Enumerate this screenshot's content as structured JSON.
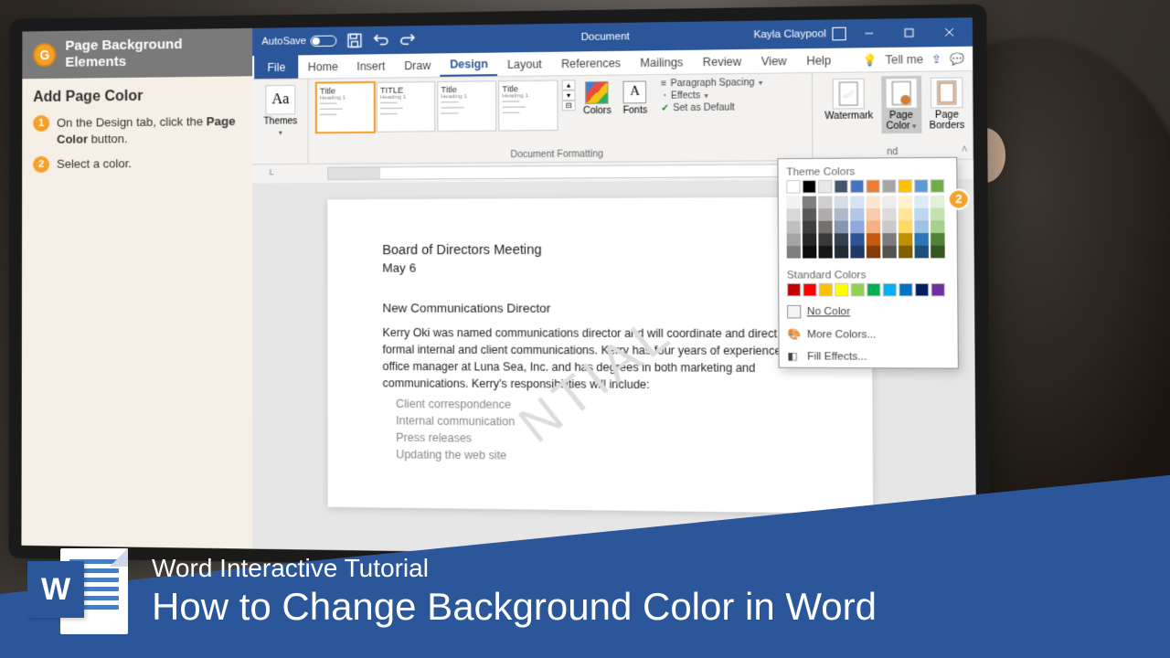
{
  "sidebar": {
    "badge": "G",
    "title": "Page Background Elements",
    "subtitle": "Add Page Color",
    "steps": [
      {
        "num": "1",
        "html": "On the Design tab, click the <b>Page Color</b> button."
      },
      {
        "num": "2",
        "html": "Select a color."
      }
    ]
  },
  "titlebar": {
    "autosave": "AutoSave",
    "autosave_state": "Off",
    "document": "Document",
    "username": "Kayla Claypool"
  },
  "tabs": {
    "file": "File",
    "items": [
      "Home",
      "Insert",
      "Draw",
      "Design",
      "Layout",
      "References",
      "Mailings",
      "Review",
      "View",
      "Help"
    ],
    "active": "Design",
    "tell_me": "Tell me"
  },
  "ribbon": {
    "themes": "Themes",
    "doc_formatting": "Document Formatting",
    "styles": [
      {
        "title": "Title",
        "sub": "Heading 1"
      },
      {
        "title": "TITLE",
        "sub": "Heading 1"
      },
      {
        "title": "Title",
        "sub": "Heading 1"
      },
      {
        "title": "Title",
        "sub": "Heading 1"
      }
    ],
    "colors": "Colors",
    "fonts": "Fonts",
    "paragraph_spacing": "Paragraph Spacing",
    "effects": "Effects",
    "set_default": "Set as Default",
    "watermark": "Watermark",
    "page_color": "Page Color",
    "page_borders": "Page Borders",
    "bg_group": "nd"
  },
  "callout2": "2",
  "picker": {
    "theme": "Theme Colors",
    "standard": "Standard Colors",
    "no_color": "No Color",
    "more": "More Colors...",
    "fill": "Fill Effects...",
    "theme_row": [
      "#ffffff",
      "#000000",
      "#e8e8e8",
      "#44546a",
      "#4472c4",
      "#ed7d31",
      "#a5a5a5",
      "#ffc000",
      "#5b9bd5",
      "#70ad47"
    ],
    "theme_shades": [
      [
        "#f2f2f2",
        "#7f7f7f",
        "#d0cece",
        "#d6dce4",
        "#d9e2f3",
        "#fbe5d5",
        "#ededed",
        "#fff2cc",
        "#deebf6",
        "#e2efd9"
      ],
      [
        "#d8d8d8",
        "#595959",
        "#aeabab",
        "#adb9ca",
        "#b4c6e7",
        "#f7cbac",
        "#dbdbdb",
        "#fee599",
        "#bdd7ee",
        "#c5e0b3"
      ],
      [
        "#bfbfbf",
        "#3f3f3f",
        "#757070",
        "#8496b0",
        "#8eaadb",
        "#f4b183",
        "#c9c9c9",
        "#ffd965",
        "#9cc3e5",
        "#a8d08d"
      ],
      [
        "#a5a5a5",
        "#262626",
        "#3a3838",
        "#323f4f",
        "#2f5496",
        "#c55a11",
        "#7b7b7b",
        "#bf9000",
        "#2e75b5",
        "#538135"
      ],
      [
        "#7f7f7f",
        "#0c0c0c",
        "#171616",
        "#222a35",
        "#1f3864",
        "#833c0b",
        "#525252",
        "#7f6000",
        "#1e4e79",
        "#375623"
      ]
    ],
    "standard_row": [
      "#c00000",
      "#ff0000",
      "#ffc000",
      "#ffff00",
      "#92d050",
      "#00b050",
      "#00b0f0",
      "#0070c0",
      "#002060",
      "#7030a0"
    ]
  },
  "ruler": {
    "corner": "L"
  },
  "doc": {
    "h1": "Board of Directors Meeting",
    "date": "May 6",
    "h2": "New Communications Director",
    "para": "Kerry Oki was named communications director and will coordinate and direct all formal internal and client communications. Kerry has four years of experience as an office manager at Luna Sea, Inc. and has degrees in both marketing and communications. Kerry's responsibilities will include:",
    "items": [
      "Client correspondence",
      "Internal communication",
      "Press releases",
      "Updating the web site"
    ],
    "watermark": "NTIAL"
  },
  "banner": {
    "logo_letter": "W",
    "subtitle": "Word Interactive Tutorial",
    "title": "How to Change Background Color in Word"
  }
}
